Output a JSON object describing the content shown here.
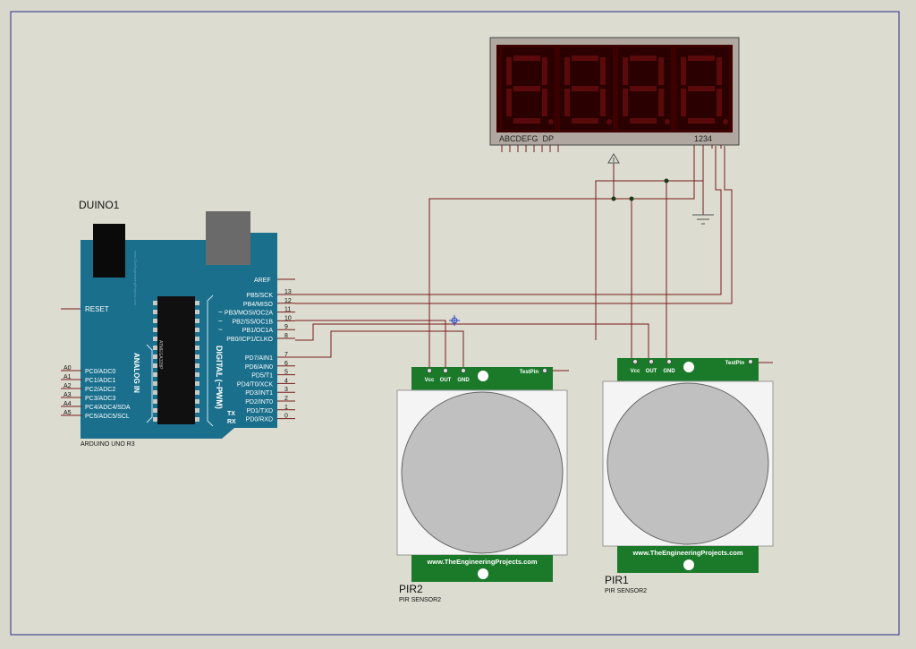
{
  "colors": {
    "sheet": "#dcdcd0",
    "border": "#2a2a8a",
    "wire": "#7a1c1c",
    "arduino_board": "#1a6f8c",
    "pir_green": "#1a7a2a",
    "pir_white": "#f4f4f4",
    "pir_lens": "#c0c0c0",
    "display_bg": "#3a0000",
    "display_segment": "#5a0a0a"
  },
  "arduino": {
    "ref": "DUINO1",
    "model": "ARDUINO UNO R3",
    "reset_label": "RESET",
    "aref_label": "AREF",
    "analog_title": "ANALOG IN",
    "digital_title": "DIGITAL (~PWM)",
    "tx_label": "TX",
    "rx_label": "RX",
    "chip_text": "ATMEGA328P",
    "analog_pins": [
      {
        "num": "A0",
        "label": "PC0/ADC0"
      },
      {
        "num": "A1",
        "label": "PC1/ADC1"
      },
      {
        "num": "A2",
        "label": "PC2/ADC2"
      },
      {
        "num": "A3",
        "label": "PC3/ADC3"
      },
      {
        "num": "A4",
        "label": "PC4/ADC4/SDA"
      },
      {
        "num": "A5",
        "label": "PC5/ADC5/SCL"
      }
    ],
    "digital_pins_top": [
      {
        "num": "13",
        "label": "PB5/SCK",
        "pwm": ""
      },
      {
        "num": "12",
        "label": "PB4/MISO",
        "pwm": ""
      },
      {
        "num": "11",
        "label": "PB3/MOSI/OC2A",
        "pwm": "~"
      },
      {
        "num": "10",
        "label": "PB2/SS/OC1B",
        "pwm": "~"
      },
      {
        "num": "9",
        "label": "PB1/OC1A",
        "pwm": "~"
      },
      {
        "num": "8",
        "label": "PB0/ICP1/CLKO",
        "pwm": ""
      }
    ],
    "digital_pins_bottom": [
      {
        "num": "7",
        "label": "PD7/AIN1",
        "pwm": ""
      },
      {
        "num": "6",
        "label": "PD6/AIN0",
        "pwm": "~"
      },
      {
        "num": "5",
        "label": "PD5/T1",
        "pwm": "~"
      },
      {
        "num": "4",
        "label": "PD4/T0/XCK",
        "pwm": ""
      },
      {
        "num": "3",
        "label": "PD3/INT1",
        "pwm": "~"
      },
      {
        "num": "2",
        "label": "PD2/INT0",
        "pwm": ""
      },
      {
        "num": "1",
        "label": "PD1/TXD",
        "pwm": ""
      },
      {
        "num": "0",
        "label": "PD0/RXD",
        "pwm": ""
      }
    ]
  },
  "display": {
    "segment_labels": "ABCDEFG  DP",
    "digit_labels": "1234",
    "digit_count": 4
  },
  "pir_sensors": [
    {
      "ref": "PIR2",
      "model": "PIR SENSOR2",
      "pin_vcc": "Vcc",
      "pin_out": "OUT",
      "pin_gnd": "GND",
      "test_pin": "TestPin",
      "website": "www.TheEngineeringProjects.com"
    },
    {
      "ref": "PIR1",
      "model": "PIR SENSOR2",
      "pin_vcc": "Vcc",
      "pin_out": "OUT",
      "pin_gnd": "GND",
      "test_pin": "TestPin",
      "website": "www.TheEngineeringProjects.com"
    }
  ]
}
